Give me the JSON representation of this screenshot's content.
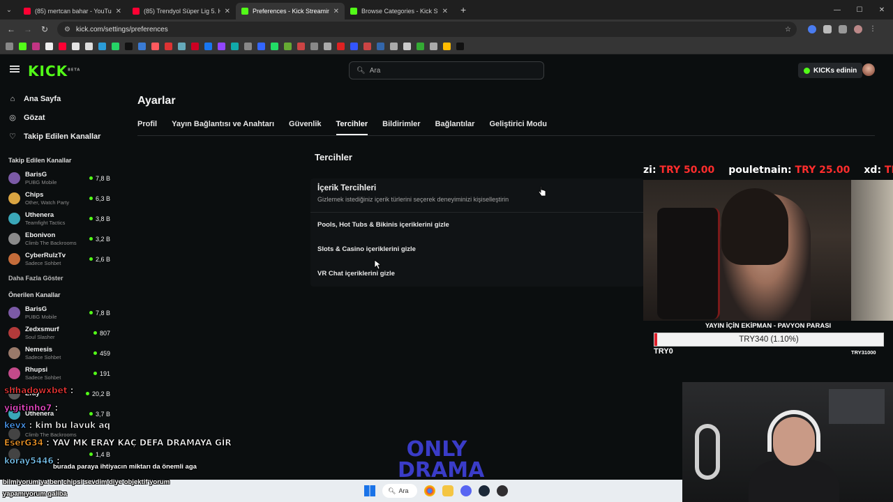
{
  "browser": {
    "tabs": [
      {
        "label": "(85) mertcan bahar - YouTube",
        "color": "#ff0033",
        "active": false
      },
      {
        "label": "(85) Trendyol Süper Lig 5. Haftası",
        "color": "#ff0033",
        "active": false
      },
      {
        "label": "Preferences - Kick Streaming",
        "color": "#53fc18",
        "active": true
      },
      {
        "label": "Browse Categories - Kick Streaming",
        "color": "#53fc18",
        "active": false
      }
    ],
    "url": "kick.com/settings/preferences"
  },
  "header": {
    "logo": "KICK",
    "logo_badge": "BETA",
    "search_placeholder": "Ara",
    "kicks_button": "KICKs edinin"
  },
  "sidebar": {
    "nav": [
      {
        "label": "Ana Sayfa",
        "icon": "home-icon"
      },
      {
        "label": "Gözat",
        "icon": "compass-icon"
      },
      {
        "label": "Takip Edilen Kanallar",
        "icon": "heart-icon"
      }
    ],
    "followed_title": "Takip Edilen Kanallar",
    "followed": [
      {
        "name": "BarisG",
        "category": "PUBG Mobile",
        "viewers": "7,8 B",
        "color": "#7b5aa6"
      },
      {
        "name": "Chips",
        "category": "Other, Watch Party",
        "viewers": "6,3 B",
        "color": "#d9a441"
      },
      {
        "name": "Uthenera",
        "category": "Teamfight Tactics",
        "viewers": "3,8 B",
        "color": "#3aa7b8"
      },
      {
        "name": "Ebonivon",
        "category": "Climb The Backrooms",
        "viewers": "3,2 B",
        "color": "#8a8a8a"
      },
      {
        "name": "CyberRulzTv",
        "category": "Sadece Sohbet",
        "viewers": "2,6 B",
        "color": "#c46c3a"
      }
    ],
    "show_more": "Daha Fazla Göster",
    "recommended_title": "Önerilen Kanallar",
    "recommended": [
      {
        "name": "BarisG",
        "category": "PUBG Mobile",
        "viewers": "7,8 B",
        "color": "#7b5aa6"
      },
      {
        "name": "Zedxsmurf",
        "category": "Soul Slasher",
        "viewers": "807",
        "color": "#b33a3a"
      },
      {
        "name": "Nemesis",
        "category": "Sadece Sohbet",
        "viewers": "459",
        "color": "#9a7a6a"
      },
      {
        "name": "Rhupsi",
        "category": "Sadece Sohbet",
        "viewers": "191",
        "color": "#c44a8a"
      },
      {
        "name": "Eray",
        "category": "",
        "viewers": "20,2 B",
        "color": "#5a5a5a"
      },
      {
        "name": "Uthenera",
        "category": "",
        "viewers": "3,7 B",
        "color": "#3aa7b8"
      },
      {
        "name": "",
        "category": "Climb The Backrooms",
        "viewers": "",
        "color": "#444"
      },
      {
        "name": "",
        "category": "",
        "viewers": "1,4 B",
        "color": "#444"
      }
    ]
  },
  "main": {
    "title": "Ayarlar",
    "tabs": [
      "Profil",
      "Yayın Bağlantısı ve Anahtarı",
      "Güvenlik",
      "Tercihler",
      "Bildirimler",
      "Bağlantılar",
      "Geliştirici Modu"
    ],
    "active_tab": "Tercihler",
    "section_title": "Tercihler",
    "card_title": "İçerik Tercihleri",
    "card_desc": "Gizlemek istediğiniz içerik türlerini seçerek deneyiminizi kişiselleştirin",
    "options": [
      "Pools, Hot Tubs & Bikinis içeriklerini gizle",
      "Slots & Casino içeriklerini gizle",
      "VR Chat içeriklerini gizle"
    ]
  },
  "overlay": {
    "donations": [
      {
        "user": "zi:",
        "amount": "TRY 50.00"
      },
      {
        "user": "pouletnain:",
        "amount": "TRY 25.00"
      },
      {
        "user": "xd:",
        "amount": "TR"
      }
    ],
    "goal_title": "YAYIN İÇİN EKİPMAN - PAVYON PARASI",
    "goal_text": "TRY340 (1.10%)",
    "goal_progress": 0.011,
    "goal_min": "TRY0",
    "goal_max": "TRY31000",
    "watermark": "ONLY DRAMA"
  },
  "chat": [
    {
      "user": "shhadowxbet",
      "text": ":",
      "color": "#ff3b3b"
    },
    {
      "user": "yigitinho7",
      "text": ":",
      "color": "#ff4fd8"
    },
    {
      "user": "kevx",
      "text": ": kim bu lavuk aq",
      "color": "#4fa3ff"
    },
    {
      "user": "EserG34",
      "text": ": YAV MK ERAY KAÇ DEFA DRAMAYA GİR",
      "color": "#ffa12b"
    },
    {
      "user": "koray5446",
      "text": ":",
      "color": "#7fd1ff"
    }
  ],
  "chat_bottom": [
    "burada paraya ihtiyacın miktarı da önemli aga",
    "bilmiyorum ya ben chipsi sevdim diye objektif yorum",
    "yapamıyorum galiba"
  ],
  "taskbar": {
    "search": "Ara"
  }
}
